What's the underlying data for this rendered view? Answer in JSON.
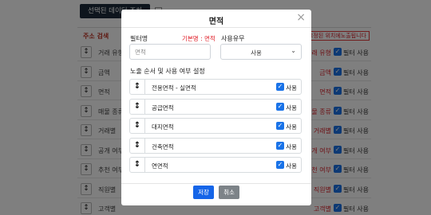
{
  "background": {
    "top_button": "선택된 데이터 조회",
    "panel_title": "주소 검색",
    "panel_note": "고정된 위치에노출됩니다",
    "rows": [
      {
        "name": "거래 유형",
        "rname": "거래 유형",
        "use": "필터 사용"
      },
      {
        "name": "금액",
        "rname": "금액",
        "use": "필터 사용"
      },
      {
        "name": "면적",
        "rname": "면적",
        "use": "필터 사용"
      },
      {
        "name": "매물 종류",
        "rname": "매물 종류",
        "use": "필터 사용"
      },
      {
        "name": "거래별",
        "rname": "거래별",
        "use": "필터 사용"
      },
      {
        "name": "공개 여부",
        "rname": "공개 여부",
        "use": "필터 사용"
      },
      {
        "name": "추천 여부",
        "rname": "추천 여부",
        "use": "필터 사용"
      },
      {
        "name": "직원별",
        "rname": "직원별",
        "use": "필터 사용"
      },
      {
        "name": "고객별",
        "rname": "고객별",
        "use": "필터 사용"
      }
    ]
  },
  "modal": {
    "title": "면적",
    "close": "×",
    "filter_label": "필터명",
    "filter_hint": "기본명 : 면적",
    "filter_placeholder": "면적",
    "use_label": "사용유무",
    "use_value": "사용",
    "order_label": "노출 순서 및 사용 여부 설정",
    "items": [
      {
        "name": "전용면적 - 실면적",
        "use": "사용"
      },
      {
        "name": "공급면적",
        "use": "사용"
      },
      {
        "name": "대지면적",
        "use": "사용"
      },
      {
        "name": "건축면적",
        "use": "사용"
      },
      {
        "name": "연면적",
        "use": "사용"
      }
    ],
    "save_label": "저장",
    "cancel_label": "취소"
  }
}
